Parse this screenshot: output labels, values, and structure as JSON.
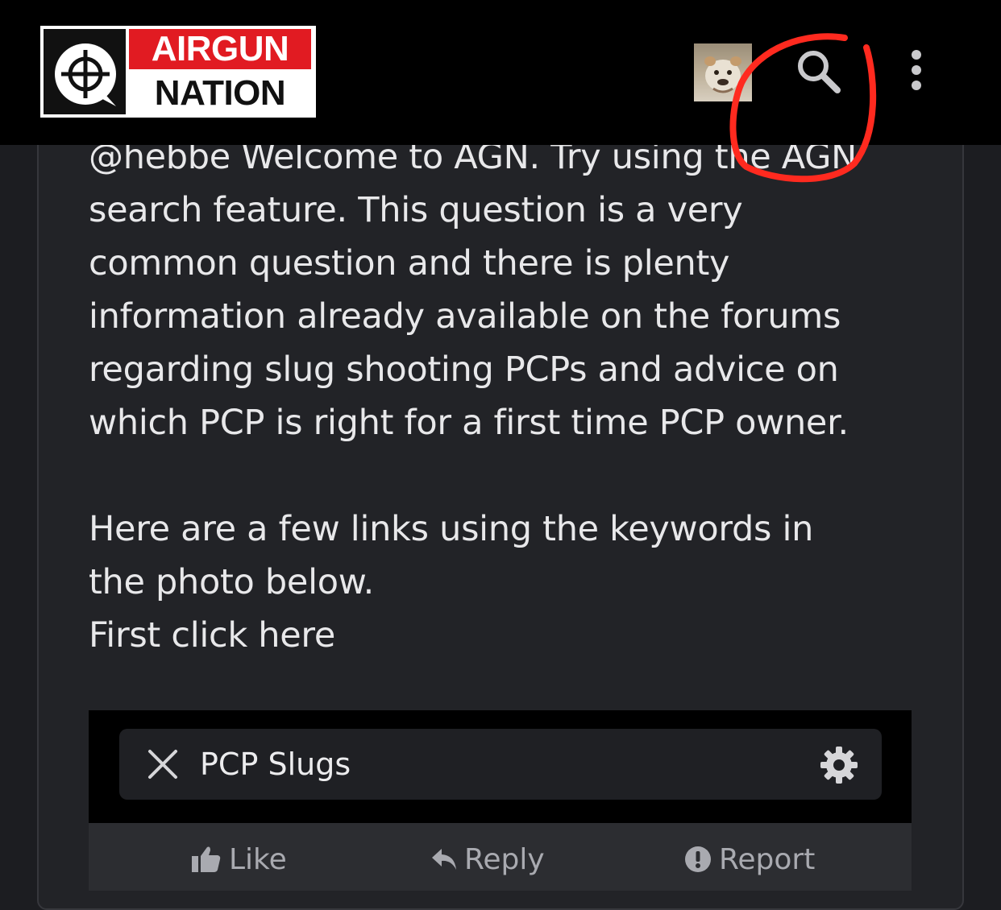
{
  "header": {
    "logo_top": "AIRGUN",
    "logo_bottom": "NATION",
    "brand_colors": {
      "red": "#e11b22",
      "dark": "#111111"
    },
    "icons": [
      "avatar",
      "search-icon",
      "more-vertical-icon"
    ]
  },
  "post": {
    "paragraphs": [
      "@hebbe Welcome to AGN. Try using the AGN",
      "search feature. This question is a very",
      "common question and there is plenty",
      "information already available on the forums",
      "regarding slug shooting PCPs and advice on",
      "which PCP is right for a first time PCP owner.",
      "Here are a few links using the keywords in",
      "the photo below.",
      "First click here"
    ]
  },
  "embed": {
    "search_query": "PCP Slugs",
    "icons": [
      "close-icon",
      "gear-icon"
    ]
  },
  "actions": {
    "like": "Like",
    "reply": "Reply",
    "report": "Report"
  },
  "annotation": {
    "color": "#ff2a1f"
  }
}
